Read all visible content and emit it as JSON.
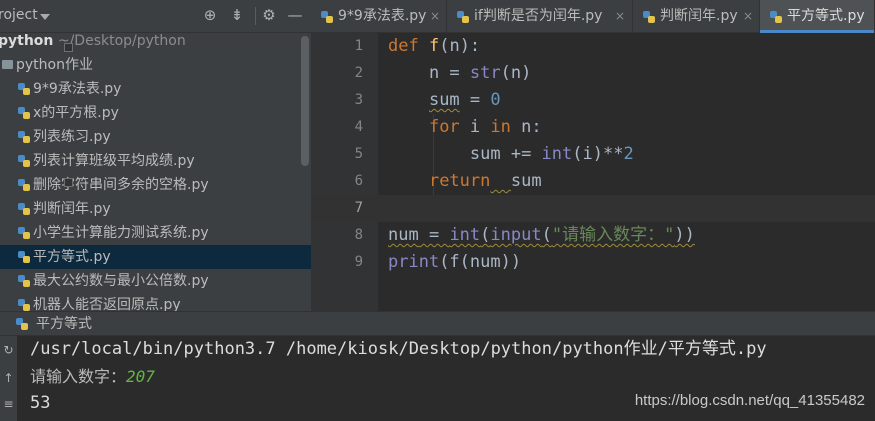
{
  "project_panel": {
    "title": "roject",
    "root_name": "python",
    "root_path": "~/Desktop/python",
    "folder_name": "python作业",
    "files": [
      "9*9承法表.py",
      "x的平方根.py",
      "列表练习.py",
      "列表计算班级平均成绩.py",
      "删除字符串间多余的空格.py",
      "判断闰年.py",
      "小学生计算能力测试系统.py",
      "平方等式.py",
      "最大公约数与最小公倍数.py",
      "机器人能否返回原点.py"
    ],
    "selected_index": 7
  },
  "tabs": [
    {
      "label": "9*9承法表.py",
      "close": "×"
    },
    {
      "label": "if判断是否为闰年.py",
      "close": "×"
    },
    {
      "label": "判断闰年.py",
      "close": "×"
    },
    {
      "label": "平方等式.py",
      "close": ""
    }
  ],
  "active_tab": 3,
  "editor": {
    "line_numbers": [
      "1",
      "2",
      "3",
      "4",
      "5",
      "6",
      "7",
      "8",
      "9"
    ],
    "current_line": 7,
    "code": {
      "l1": {
        "kw_def": "def",
        "fname": "f",
        "rest": "(n):"
      },
      "l2": {
        "pre": "n = ",
        "bi": "str",
        "post": "(n)"
      },
      "l3": {
        "var": "sum",
        "mid": " = ",
        "num": "0"
      },
      "l4": {
        "kw_for": "for",
        "mid1": " i ",
        "kw_in": "in",
        "mid2": " n:"
      },
      "l5": {
        "pre": "sum += ",
        "bi": "int",
        "mid": "(i)**",
        "num": "2"
      },
      "l6": {
        "kw_ret": "return",
        "gap": "  ",
        "var": "sum"
      },
      "l8": {
        "var": "num",
        "eq": " = ",
        "bi1": "int",
        "p1": "(",
        "bi2": "input",
        "p2": "(",
        "str": "\"请输入数字：\"",
        "p3": "))"
      },
      "l9": {
        "bi1": "print",
        "rest": "(f(num))"
      }
    }
  },
  "run_panel": {
    "title": "平方等式",
    "command": "/usr/local/bin/python3.7 /home/kiosk/Desktop/python/python作业/平方等式.py",
    "prompt": "请输入数字：",
    "user_input": "207",
    "output": "53"
  },
  "watermark": "https://blog.csdn.net/qq_41355482",
  "icons": {
    "dropdown": "chevron-down-icon",
    "locate": "crosshair-icon",
    "collapse": "collapse-all-icon",
    "settings": "gear-icon",
    "hide": "minimize-icon",
    "rerun": "rerun-icon",
    "scroll_up": "arrow-up-icon",
    "wrap": "soft-wrap-icon"
  },
  "colors": {
    "keyword": "#cc7832",
    "function": "#ffc66d",
    "builtin": "#8888c6",
    "number": "#6897bb",
    "string": "#6a8759",
    "selection": "#0d293e",
    "tab_underline": "#4a88c7",
    "user_input": "#62b543"
  }
}
